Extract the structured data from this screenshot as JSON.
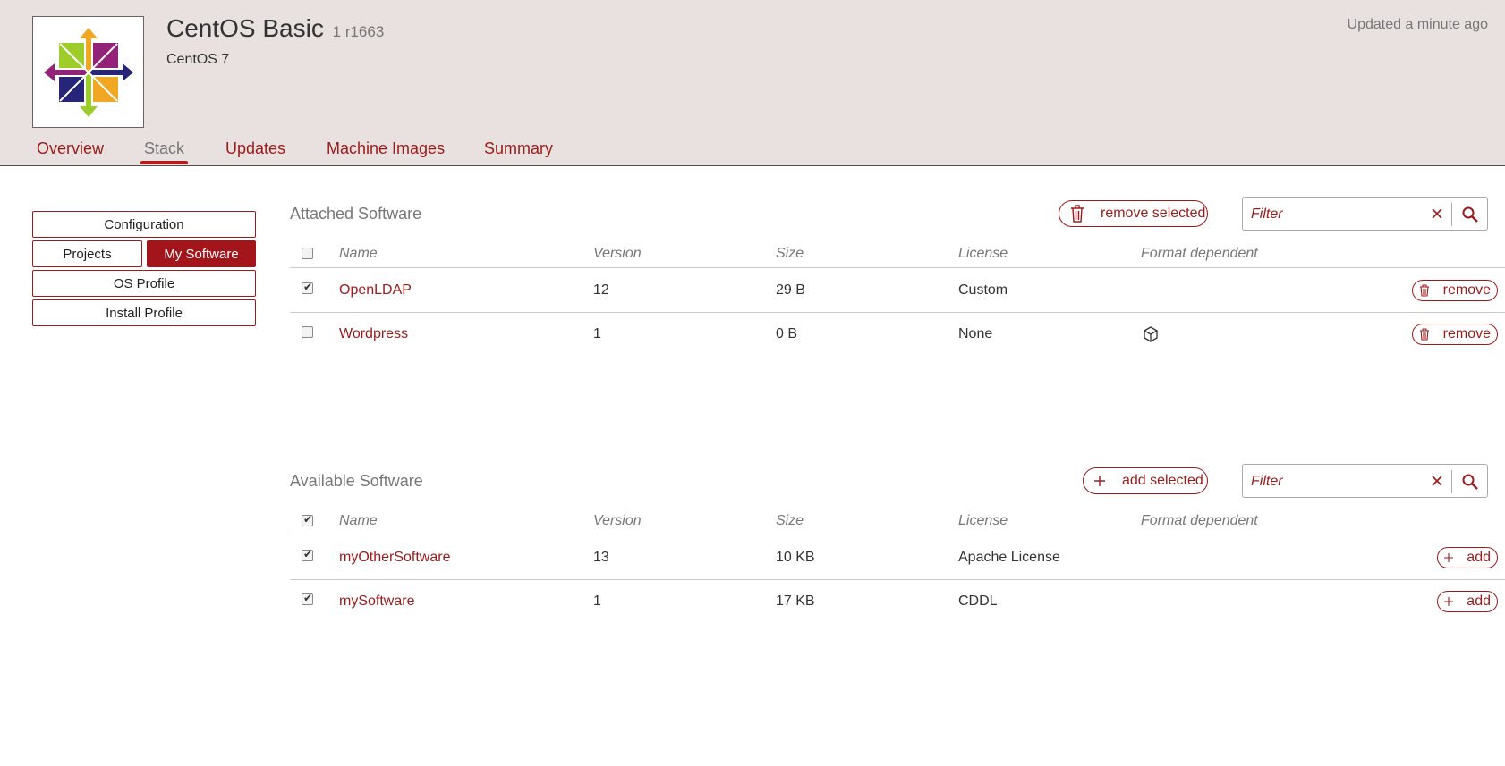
{
  "header": {
    "title": "CentOS Basic",
    "version": "1 r1663",
    "subtitle": "CentOS 7",
    "updated": "Updated a minute ago"
  },
  "tabs": [
    {
      "label": "Overview"
    },
    {
      "label": "Stack"
    },
    {
      "label": "Updates"
    },
    {
      "label": "Machine Images"
    },
    {
      "label": "Summary"
    }
  ],
  "active_tab": "Stack",
  "sidebar": {
    "configuration": "Configuration",
    "projects": "Projects",
    "my_software": "My Software",
    "os_profile": "OS Profile",
    "install_profile": "Install Profile",
    "active": "My Software"
  },
  "attached": {
    "title": "Attached Software",
    "remove_selected": "remove selected",
    "filter_placeholder": "Filter",
    "columns": {
      "name": "Name",
      "version": "Version",
      "size": "Size",
      "license": "License",
      "format": "Format dependent"
    },
    "rows": [
      {
        "name": "OpenLDAP",
        "version": "12",
        "size": "29 B",
        "license": "Custom",
        "format_icon": "",
        "checked": true,
        "action": "remove"
      },
      {
        "name": "Wordpress",
        "version": "1",
        "size": "0 B",
        "license": "None",
        "format_icon": "cube-icon",
        "checked": false,
        "action": "remove"
      }
    ]
  },
  "available": {
    "title": "Available Software",
    "add_selected": "add selected",
    "filter_placeholder": "Filter",
    "header_checked": true,
    "columns": {
      "name": "Name",
      "version": "Version",
      "size": "Size",
      "license": "License",
      "format": "Format dependent"
    },
    "rows": [
      {
        "name": "myOtherSoftware",
        "version": "13",
        "size": "10 KB",
        "license": "Apache License",
        "checked": true,
        "action": "add"
      },
      {
        "name": "mySoftware",
        "version": "1",
        "size": "17 KB",
        "license": "CDDL",
        "checked": true,
        "action": "add"
      }
    ]
  },
  "colors": {
    "accent": "#9b1b1b",
    "accent_active": "#a3151b",
    "header_bg": "#e8e1e0"
  }
}
